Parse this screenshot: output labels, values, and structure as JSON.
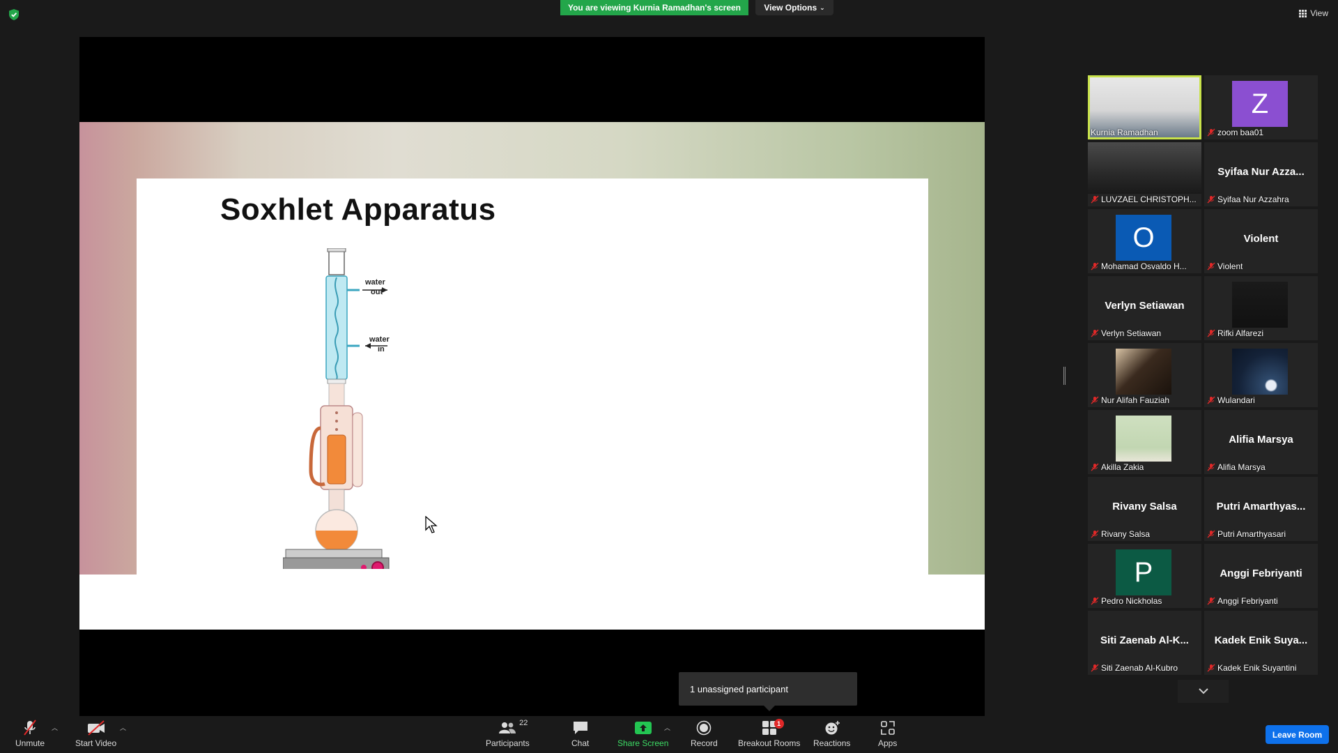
{
  "top": {
    "banner": "You are viewing Kurnia Ramadhan's screen",
    "view_options": "View Options",
    "view": "View"
  },
  "slide": {
    "title": "Soxhlet Apparatus",
    "water_out_1": "water",
    "water_out_2": "out",
    "water_in_1": "water",
    "water_in_2": "in"
  },
  "toast": {
    "unassigned": "1 unassigned participant"
  },
  "participants": [
    {
      "name": "Kurnia Ramadhan",
      "kind": "photo",
      "active": true
    },
    {
      "name": "zoom baa01",
      "kind": "avatar",
      "initial": "Z",
      "color": "#8b4fd1",
      "muted": true
    },
    {
      "name": "LUVZAEL CHRISTOPH...",
      "kind": "photo",
      "muted": true
    },
    {
      "name": "Syifaa Nur Azzahra",
      "kind": "text",
      "big": "Syifaa Nur Azza...",
      "muted": true
    },
    {
      "name": "Mohamad Osvaldo H...",
      "kind": "avatar",
      "initial": "O",
      "color": "#0a5ab4",
      "muted": true
    },
    {
      "name": "Violent",
      "kind": "text",
      "big": "Violent",
      "muted": true
    },
    {
      "name": "Verlyn Setiawan",
      "kind": "text",
      "big": "Verlyn Setiawan",
      "muted": true
    },
    {
      "name": "Rifki Alfarezi",
      "kind": "photo",
      "muted": true
    },
    {
      "name": "Nur Alifah Fauziah",
      "kind": "photo",
      "muted": true
    },
    {
      "name": "Wulandari",
      "kind": "photo",
      "muted": true
    },
    {
      "name": "Akilla Zakia",
      "kind": "photo",
      "muted": true
    },
    {
      "name": "Alifia Marsya",
      "kind": "text",
      "big": "Alifia Marsya",
      "muted": true
    },
    {
      "name": "Rivany Salsa",
      "kind": "text",
      "big": "Rivany Salsa",
      "muted": true
    },
    {
      "name": "Putri Amarthyasari",
      "kind": "text",
      "big": "Putri Amarthyas...",
      "muted": true
    },
    {
      "name": "Pedro Nickholas",
      "kind": "avatar",
      "initial": "P",
      "color": "#0c5a44",
      "muted": true
    },
    {
      "name": "Anggi Febriyanti",
      "kind": "text",
      "big": "Anggi Febriyanti",
      "muted": true
    },
    {
      "name": "Siti Zaenab Al-Kubro",
      "kind": "text",
      "big": "Siti Zaenab Al-K...",
      "muted": true
    },
    {
      "name": "Kadek Enik Suyantini",
      "kind": "text",
      "big": "Kadek Enik Suya...",
      "muted": true
    }
  ],
  "toolbar": {
    "unmute": "Unmute",
    "start_video": "Start Video",
    "participants": "Participants",
    "participants_count": "22",
    "chat": "Chat",
    "share_screen": "Share Screen",
    "record": "Record",
    "breakout_rooms": "Breakout Rooms",
    "breakout_badge": "1",
    "reactions": "Reactions",
    "apps": "Apps",
    "leave_room": "Leave Room"
  },
  "colors": {
    "banner_green": "#23a64a",
    "active_speaker": "#c8e24a",
    "leave_blue": "#0e71eb",
    "mute_red": "#e02828"
  }
}
